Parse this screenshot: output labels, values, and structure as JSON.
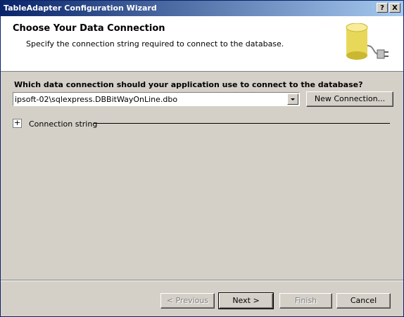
{
  "window": {
    "title": "TableAdapter Configuration Wizard",
    "help_glyph": "?",
    "close_glyph": "X"
  },
  "header": {
    "title": "Choose Your Data Connection",
    "subtitle": "Specify the connection string required to connect to the database."
  },
  "main": {
    "question": "Which data connection should your application use to connect to the database?",
    "connection_value": "ipsoft-02\\sqlexpress.DBBitWayOnLine.dbo",
    "new_connection_label": "New Connection...",
    "expand_glyph": "+",
    "connection_string_label": "Connection string"
  },
  "footer": {
    "previous_label": "< Previous",
    "next_label": "Next >",
    "finish_label": "Finish",
    "cancel_label": "Cancel"
  },
  "colors": {
    "title_bar_start": "#0a246a",
    "title_bar_end": "#a6caf0",
    "dialog_face": "#d4d0c8"
  }
}
